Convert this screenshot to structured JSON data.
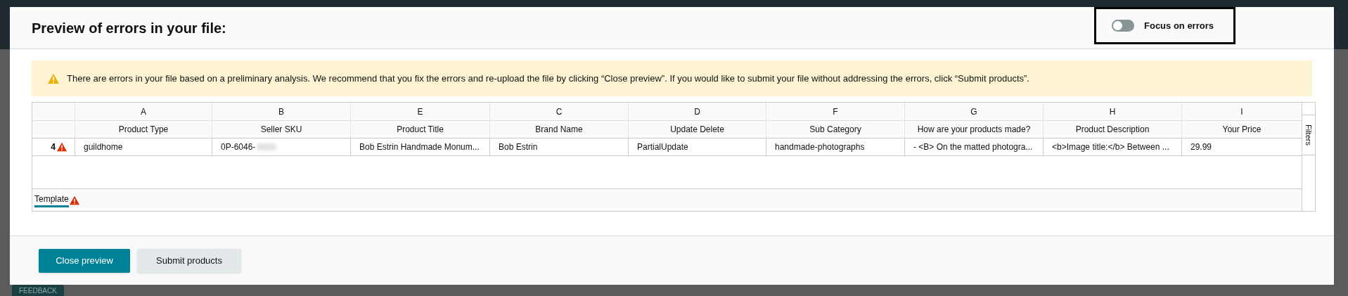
{
  "dialog": {
    "title": "Preview of errors in your file:",
    "focus_toggle": {
      "label": "Focus on errors",
      "on": false
    }
  },
  "warning": "There are errors in your file based on a preliminary analysis. We recommend that you fix the errors and re-upload the file by clicking “Close preview”. If you would like to submit your file without addressing the errors, click “Submit products”.",
  "table": {
    "columns": [
      {
        "letter": "A",
        "name": "Product Type"
      },
      {
        "letter": "B",
        "name": "Seller SKU"
      },
      {
        "letter": "E",
        "name": "Product Title"
      },
      {
        "letter": "C",
        "name": "Brand Name"
      },
      {
        "letter": "D",
        "name": "Update Delete"
      },
      {
        "letter": "F",
        "name": "Sub Category"
      },
      {
        "letter": "G",
        "name": "How are your products made?"
      },
      {
        "letter": "H",
        "name": "Product Description"
      },
      {
        "letter": "I",
        "name": "Your Price"
      }
    ],
    "rows": [
      {
        "number": "4",
        "error": true,
        "cells": [
          {
            "text": "guildhome"
          },
          {
            "text": "0P-6046-",
            "redacted": true
          },
          {
            "text": "Bob Estrin Handmade Monum..."
          },
          {
            "text": "Bob Estrin"
          },
          {
            "text": "PartialUpdate"
          },
          {
            "text": "handmade-photographs"
          },
          {
            "text": "- <B>  On the matted photogra..."
          },
          {
            "text": "<b>Image title:</b>  Between ..."
          },
          {
            "text": "29.99"
          }
        ]
      }
    ],
    "side_tab": "Filters",
    "sheet_tabs": [
      {
        "label": "Template",
        "selected": true,
        "error": true
      }
    ]
  },
  "buttons": [
    {
      "label": "Close preview",
      "kind": "primary"
    },
    {
      "label": "Submit products",
      "kind": "secondary"
    }
  ],
  "feedback_tab": "FEEDBACK"
}
